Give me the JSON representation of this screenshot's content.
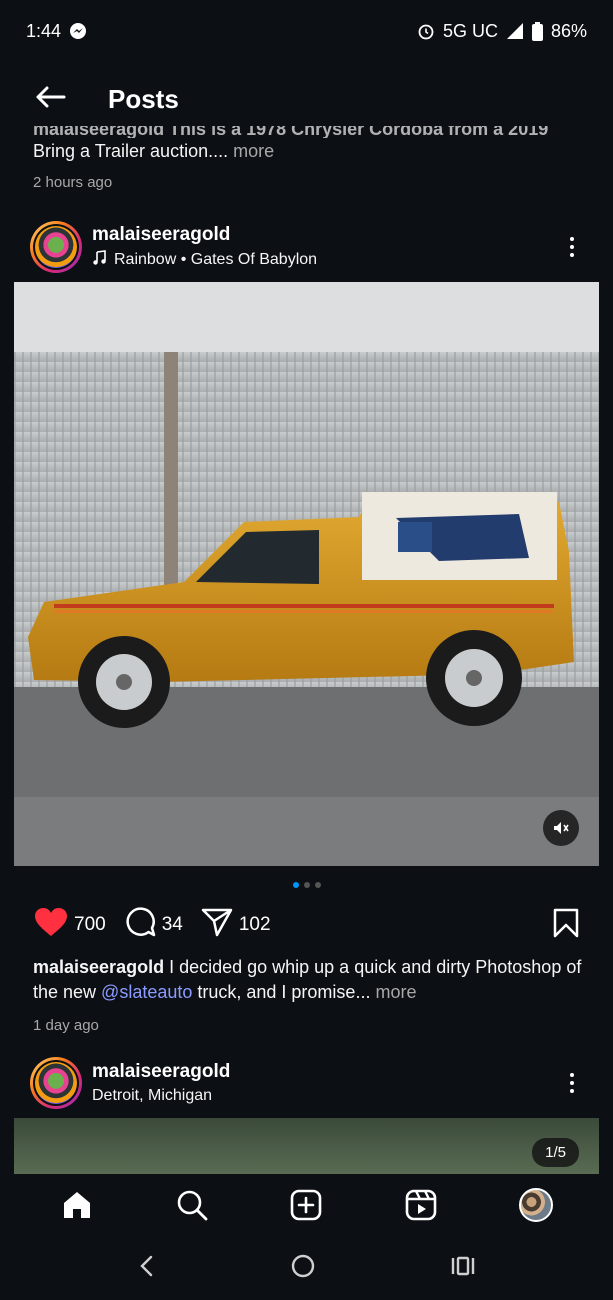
{
  "status_bar": {
    "time": "1:44",
    "network": "5G UC",
    "battery": "86%"
  },
  "header": {
    "title": "Posts"
  },
  "previous_post": {
    "caption_cut": "malaiseeragold This is a 1978 Chrysler Cordoba from a 2019",
    "caption": "Bring a Trailer auction....",
    "more": "more",
    "time": "2 hours ago"
  },
  "post": {
    "username": "malaiseeragold",
    "audio": "Rainbow • Gates Of Babylon",
    "likes": "700",
    "comments": "34",
    "shares": "102",
    "caption_user": "malaiseeragold",
    "caption_text_1": " I decided go whip up a quick and dirty Photoshop of the new ",
    "mention": "@slateauto",
    "caption_text_2": " truck, and I promise...",
    "more": "more",
    "time": "1 day ago",
    "carousel_total": 3,
    "carousel_active": 1
  },
  "next_post": {
    "username": "malaiseeragold",
    "location": "Detroit, Michigan",
    "counter": "1/5"
  },
  "colors": {
    "like_red": "#ff3040",
    "mention_blue": "#8c9bff",
    "carousel_active": "#0095f6",
    "background": "#0c1014"
  },
  "icons": [
    "back-arrow-icon",
    "heart-icon",
    "comment-icon",
    "share-icon",
    "bookmark-icon",
    "home-icon",
    "search-icon",
    "create-icon",
    "reels-icon",
    "mute-icon",
    "music-note-icon"
  ]
}
